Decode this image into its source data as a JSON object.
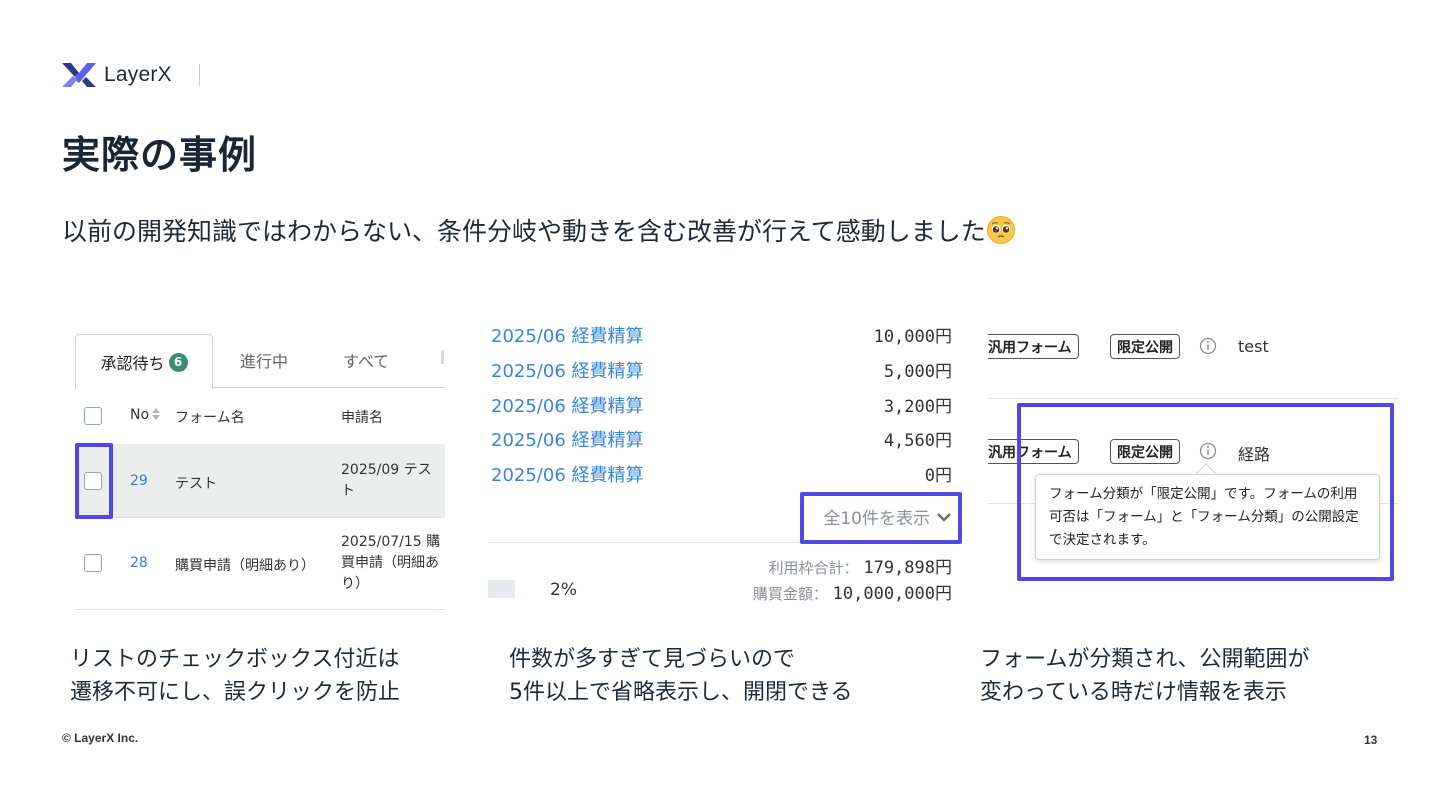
{
  "brand": {
    "name": "LayerX",
    "colors": {
      "accent": "#5146ea",
      "logo_dark": "#2f3a8c",
      "logo_light": "#5a63e6",
      "link": "#3a86d6",
      "badge": "#3d8a75"
    }
  },
  "slide": {
    "title": "実際の事例",
    "lead": "以前の開発知識ではわからない、条件分岐や動きを含む改善が行えて感動しました",
    "emoji": "pleading-face-icon"
  },
  "panel1": {
    "tabs": [
      {
        "label": "承認待ち",
        "badge": "6"
      },
      {
        "label": "進行中"
      },
      {
        "label": "すべて"
      }
    ],
    "columns": {
      "no": "No",
      "form": "フォーム名",
      "application": "申請名"
    },
    "rows": [
      {
        "no": "29",
        "form": "テスト",
        "application": "2025/09 テスト"
      },
      {
        "no": "28",
        "form": "購買申請（明細あり）",
        "application": "2025/07/15 購買申請（明細あり）"
      }
    ]
  },
  "panel2": {
    "expenses": [
      {
        "label": "2025/06 経費精算",
        "amount": "10,000円"
      },
      {
        "label": "2025/06 経費精算",
        "amount": "5,000円"
      },
      {
        "label": "2025/06 経費精算",
        "amount": "3,200円"
      },
      {
        "label": "2025/06 経費精算",
        "amount": "4,560円"
      },
      {
        "label": "2025/06 経費精算",
        "amount": "0円"
      }
    ],
    "show_all": "全10件を表示",
    "usage_label": "利用枠合計：",
    "usage_value": "179,898円",
    "purchase_label": "購買金額：",
    "purchase_value": "10,000,000円",
    "percent": "2%"
  },
  "panel3": {
    "rows": [
      {
        "form_tag": "汎用フォーム",
        "scope_tag": "限定公開",
        "value": "test"
      },
      {
        "form_tag": "汎用フォーム",
        "scope_tag": "限定公開",
        "value": "経路"
      }
    ],
    "tooltip": "フォーム分類が「限定公開」です。フォームの利用可否は「フォーム」と「フォーム分類」の公開設定で決定されます。"
  },
  "captions": [
    {
      "line1": "リストのチェックボックス付近は",
      "line2": "遷移不可にし、誤クリックを防止"
    },
    {
      "line1": "件数が多すぎて見づらいので",
      "line2": "5件以上で省略表示し、開閉できる"
    },
    {
      "line1": "フォームが分類され、公開範囲が",
      "line2": "変わっている時だけ情報を表示"
    }
  ],
  "footer": {
    "copyright": "© LayerX Inc.",
    "page": "13"
  }
}
